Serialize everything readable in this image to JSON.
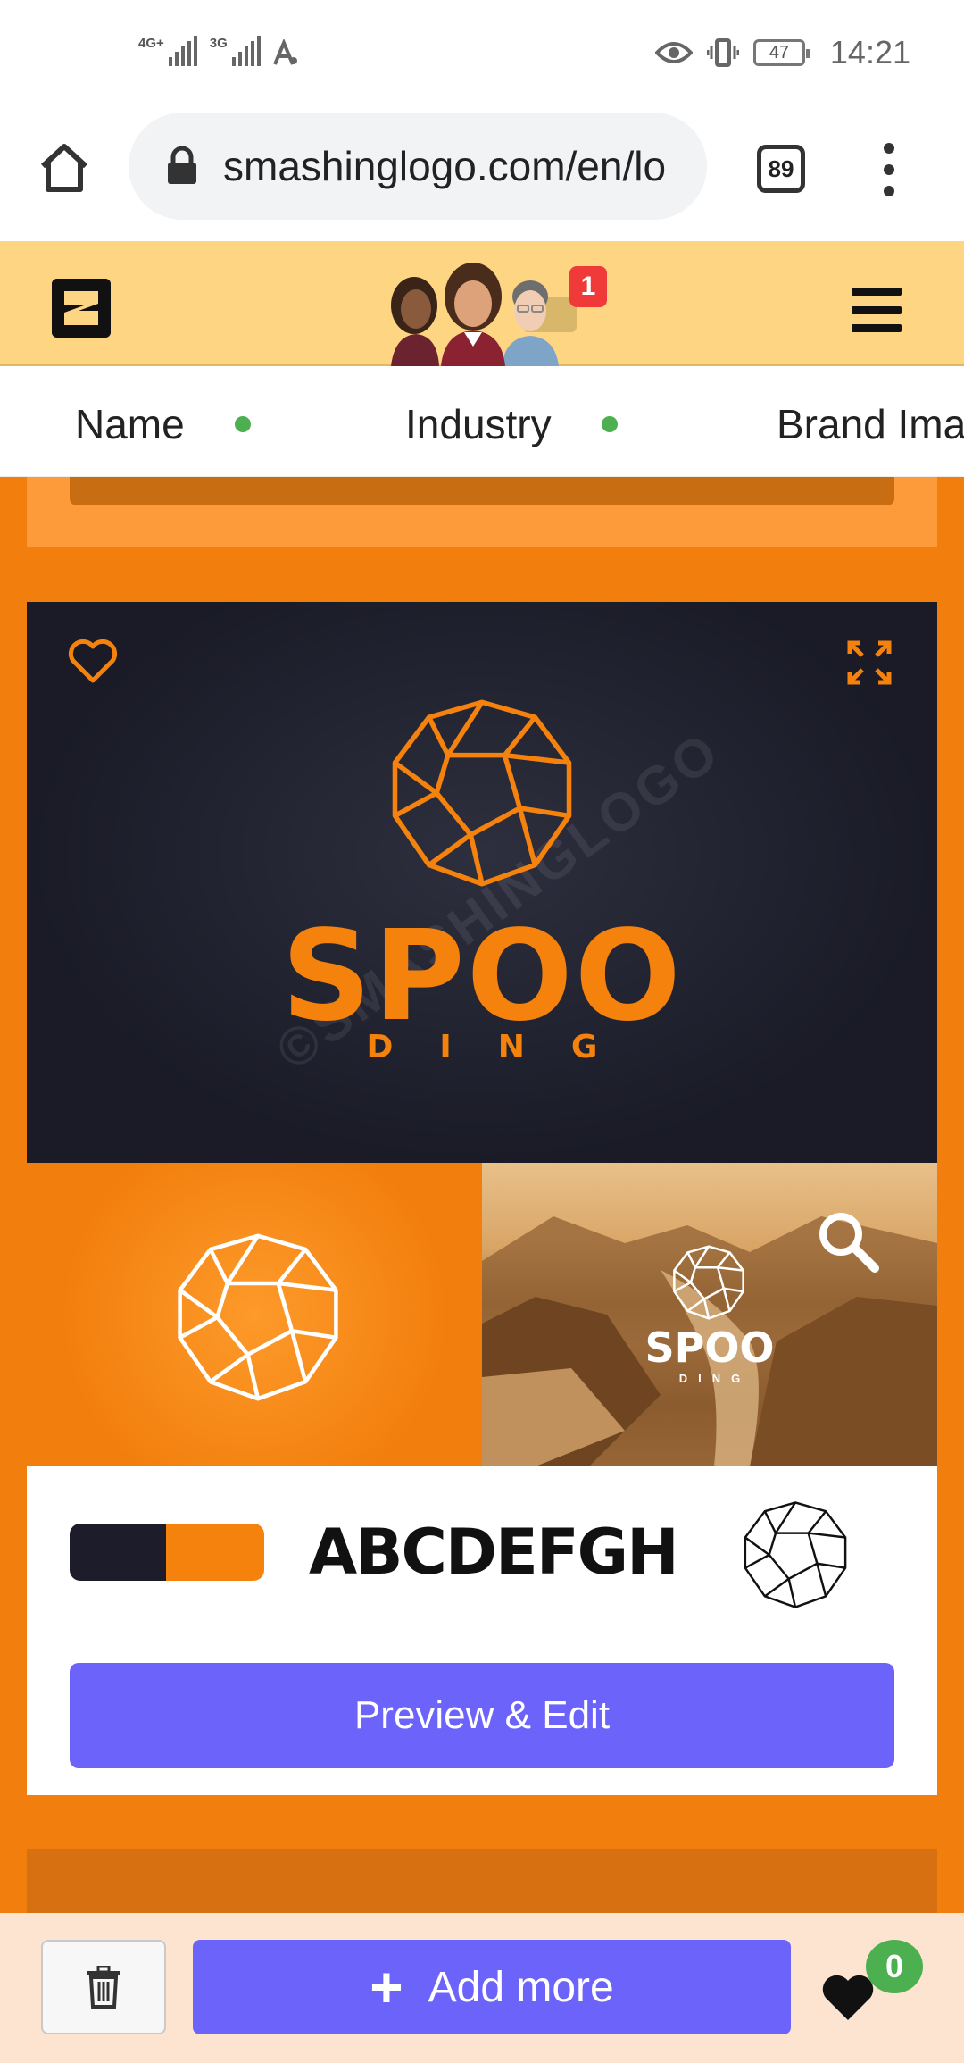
{
  "status_bar": {
    "signal_1_tag": "4G+",
    "signal_2_tag": "3G",
    "battery": "47",
    "time": "14:21",
    "icons": [
      "eye-icon",
      "vibrate-icon",
      "battery-icon"
    ]
  },
  "browser": {
    "url": "smashinglogo.com/en/lo",
    "tab_count": "89"
  },
  "header": {
    "notification_count": "1"
  },
  "filter_tabs": [
    {
      "label": "Name"
    },
    {
      "label": "Industry"
    },
    {
      "label": "Brand Ima"
    }
  ],
  "card": {
    "brand_name": "SPOO",
    "brand_sub": "DING",
    "watermark": "©SMASHINGLOGO",
    "colors": [
      "#1c1c2b",
      "#f5820d"
    ],
    "font_sample": "ABCDEFGH",
    "preview_button": "Preview & Edit"
  },
  "bottom_bar": {
    "add_more_label": "Add more",
    "favorites_count": "0"
  },
  "colors": {
    "accent": "#6c63fa",
    "brand_orange": "#f27f0d",
    "header_bg": "#fdd583",
    "dot_green": "#4caf50"
  }
}
